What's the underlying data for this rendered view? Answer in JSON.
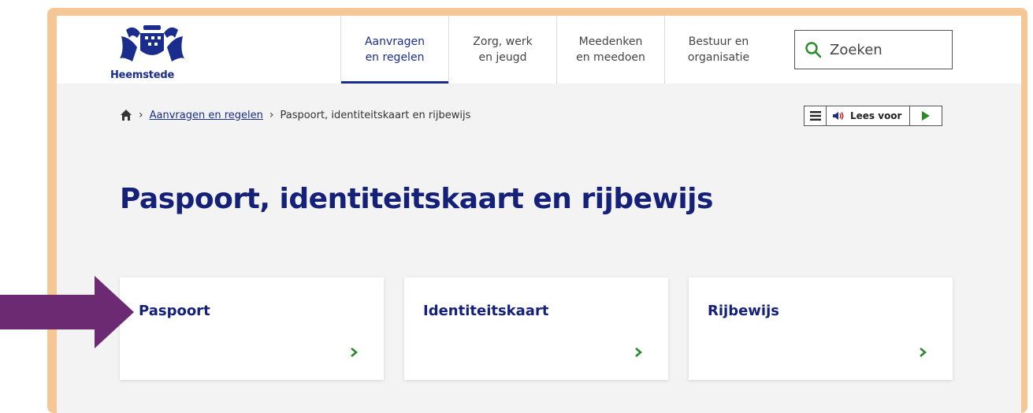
{
  "header": {
    "logo_text": "Heemstede",
    "nav": [
      {
        "label": "Aanvragen\nen regelen",
        "active": true
      },
      {
        "label": "Zorg, werk\nen jeugd",
        "active": false
      },
      {
        "label": "Meedenken\nen meedoen",
        "active": false
      },
      {
        "label": "Bestuur en\norganisatie",
        "active": false
      }
    ],
    "search_label": "Zoeken"
  },
  "breadcrumb": {
    "link": "Aanvragen en regelen",
    "current": "Paspoort, identiteitskaart en rijbewijs"
  },
  "readbar": {
    "label": "Lees voor"
  },
  "page_title": "Paspoort, identiteitskaart en rijbewijs",
  "cards": [
    {
      "title": "Paspoort"
    },
    {
      "title": "Identiteitskaart"
    },
    {
      "title": "Rijbewijs"
    }
  ],
  "colors": {
    "brand": "#152178",
    "accent_green": "#2a8a2a",
    "frame": "#f5c794",
    "arrow": "#6b2a72"
  }
}
